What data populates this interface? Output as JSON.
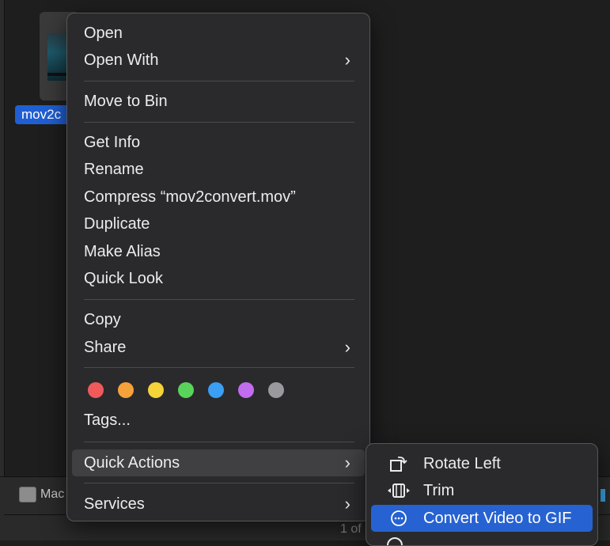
{
  "file": {
    "label": "mov2convert.mov",
    "visible_label": "mov2c"
  },
  "status_bar": {
    "drive_label": "Mac",
    "count_label": "1 of"
  },
  "context_menu": {
    "open": "Open",
    "open_with": "Open With",
    "move_to_bin": "Move to Bin",
    "get_info": "Get Info",
    "rename": "Rename",
    "compress": "Compress “mov2convert.mov”",
    "duplicate": "Duplicate",
    "make_alias": "Make Alias",
    "quick_look": "Quick Look",
    "copy": "Copy",
    "share": "Share",
    "tags": "Tags...",
    "quick_actions": "Quick Actions",
    "services": "Services",
    "chevron": "›",
    "tag_colors": [
      "#f05a5a",
      "#f5a23a",
      "#f5d339",
      "#5ad35a",
      "#3a9ff5",
      "#c26cf0",
      "#9a9a9e"
    ]
  },
  "submenu": {
    "rotate_left": "Rotate Left",
    "trim": "Trim",
    "convert_gif": "Convert Video to GIF"
  },
  "colors": {
    "highlight": "#2662d1",
    "menu_bg": "#2a2a2d"
  }
}
